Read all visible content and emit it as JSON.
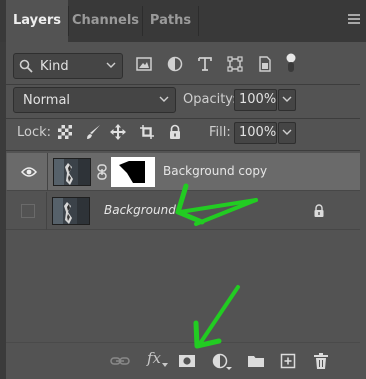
{
  "tabs": [
    {
      "label": "Layers",
      "active": true
    },
    {
      "label": "Channels",
      "active": false
    },
    {
      "label": "Paths",
      "active": false
    }
  ],
  "filter": {
    "kind_label": "Kind"
  },
  "blend": {
    "mode": "Normal",
    "opacity_label": "Opacity:",
    "opacity_value": "100%"
  },
  "lock": {
    "label": "Lock:",
    "fill_label": "Fill:",
    "fill_value": "100%"
  },
  "layers": [
    {
      "name": "Background copy",
      "visible": true,
      "has_mask": true,
      "selected": true
    },
    {
      "name": "Background",
      "visible": false,
      "locked": true,
      "selected": false
    }
  ],
  "bottom": {
    "fx_label": "fx"
  },
  "colors": {
    "panel": "#535353",
    "tabbar": "#393939",
    "selected_row": "#6a6a6a",
    "arrow": "#22cc22"
  }
}
